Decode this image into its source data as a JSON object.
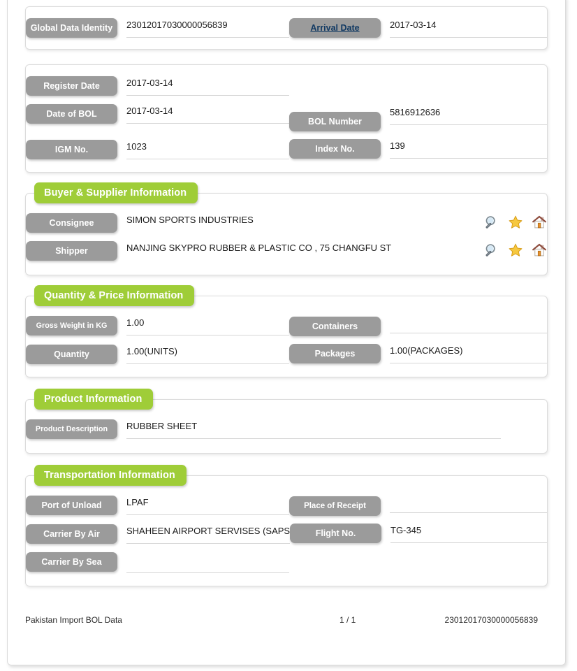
{
  "document": {
    "title": "Pakistan Import BOL Data"
  },
  "identity_panel": {
    "fields": [
      {
        "label": "Global Data Identity",
        "value": "23012017030000056839",
        "is_link": false
      },
      {
        "label": "Arrival Date",
        "value": "2017-03-14",
        "is_link": true
      }
    ]
  },
  "bol_panel": {
    "fields": [
      {
        "label": "Register Date",
        "value": "2017-03-14"
      },
      {
        "label": "Date of BOL",
        "value": "2017-03-14"
      },
      {
        "label": "BOL Number",
        "value": "5816912636"
      },
      {
        "label": "IGM No.",
        "value": "1023"
      },
      {
        "label": "Index No.",
        "value": "139"
      }
    ]
  },
  "buyer_supplier": {
    "legend": "Buyer & Supplier Information",
    "fields": [
      {
        "label": "Consignee",
        "value": "SIMON SPORTS INDUSTRIES"
      },
      {
        "label": "Shipper",
        "value": "NANJING SKYPRO RUBBER & PLASTIC CO , 75 CHANGFU ST"
      }
    ],
    "icons": [
      {
        "name": "search-icon",
        "title": "Search"
      },
      {
        "name": "star-icon",
        "title": "Favorite"
      },
      {
        "name": "home-icon",
        "title": "Home"
      }
    ]
  },
  "quantity_price": {
    "legend": "Quantity & Price Information",
    "fields": [
      {
        "label": "Gross Weight in KG",
        "value": "1.00"
      },
      {
        "label": "Containers",
        "value": ""
      },
      {
        "label": "Quantity",
        "value": "1.00(UNITS)"
      },
      {
        "label": "Packages",
        "value": "1.00(PACKAGES)"
      }
    ]
  },
  "product": {
    "legend": "Product Information",
    "fields": [
      {
        "label": "Product Description",
        "value": "RUBBER SHEET"
      }
    ]
  },
  "transportation": {
    "legend": "Transportation Information",
    "fields": [
      {
        "label": "Port of Unload",
        "value": "LPAF"
      },
      {
        "label": "Place of Receipt",
        "value": ""
      },
      {
        "label": "Carrier By Air",
        "value": "SHAHEEN AIRPORT SERVISES (SAPS"
      },
      {
        "label": "Flight No.",
        "value": "TG-345"
      },
      {
        "label": "Carrier By Sea",
        "value": ""
      }
    ]
  },
  "footer": {
    "source": "Pakistan Import BOL Data",
    "page": "1 / 1",
    "identity": "23012017030000056839"
  },
  "colors": {
    "legend_green": "#9fcd38",
    "label_gray": "#9b9b9b",
    "link_blue": "#123a63",
    "underline": "#d6d6d6"
  }
}
